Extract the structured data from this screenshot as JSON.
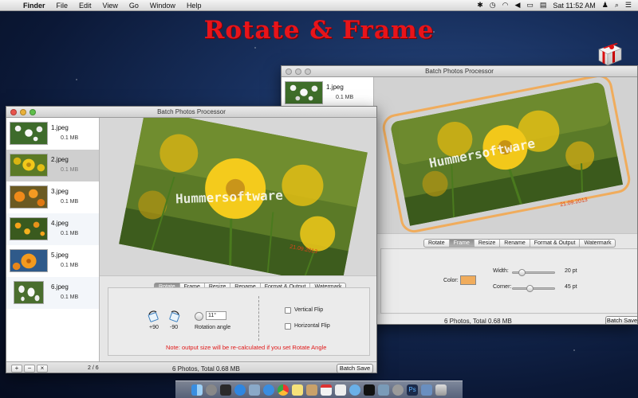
{
  "menubar": {
    "app_name": "Finder",
    "items": [
      "File",
      "Edit",
      "View",
      "Go",
      "Window",
      "Help"
    ],
    "clock": "Sat 11:52 AM"
  },
  "promo_title": "Rotate & Frame",
  "front_window": {
    "title": "Batch Photos Processor",
    "photos": [
      {
        "name": "1.jpeg",
        "size": "0.1 MB"
      },
      {
        "name": "2.jpeg",
        "size": "0.1 MB"
      },
      {
        "name": "3.jpeg",
        "size": "0.1 MB"
      },
      {
        "name": "4.jpeg",
        "size": "0.1 MB"
      },
      {
        "name": "5.jpeg",
        "size": "0.1 MB"
      },
      {
        "name": "6.jpeg",
        "size": "0.1 MB"
      }
    ],
    "selected_index": 1,
    "watermark_text": "Hummersoftware",
    "date_stamp": "21.09.2013",
    "tabs": [
      "Rotate",
      "Frame",
      "Resize",
      "Rename",
      "Format & Output",
      "Watermark"
    ],
    "active_tab": "Rotate",
    "rotate": {
      "plus90": "+90",
      "minus90": "-90",
      "angle_value": "11°",
      "angle_label": "Rotation angle",
      "vertical_flip": "Vertical Flip",
      "horizontal_flip": "Horizontal Flip",
      "note": "Note: output size will be re-calculated if you set Rotate Angle"
    },
    "footer": {
      "add": "+",
      "remove": "−",
      "clear": "×",
      "page": "2 / 6",
      "status": "6 Photos, Total 0.68 MB",
      "save": "Batch Save"
    }
  },
  "back_window": {
    "title": "Batch Photos Processor",
    "photo": {
      "name": "1.jpeg",
      "size": "0.1 MB"
    },
    "watermark_text": "Hummersoftware",
    "date_stamp": "21.09.2013",
    "tabs": [
      "Rotate",
      "Frame",
      "Resize",
      "Rename",
      "Format & Output",
      "Watermark"
    ],
    "active_tab": "Frame",
    "frame": {
      "color_label": "Color:",
      "frame_color": "#f0ac5c",
      "width_label": "Width:",
      "width_value": "20 pt",
      "corner_label": "Corner:",
      "corner_value": "45 pt"
    },
    "footer": {
      "status": "6 Photos, Total 0.68 MB",
      "save": "Batch Save"
    }
  },
  "colors": {
    "promo": "#e8141a",
    "note": "#e01818",
    "frame": "#f0ac5c"
  }
}
